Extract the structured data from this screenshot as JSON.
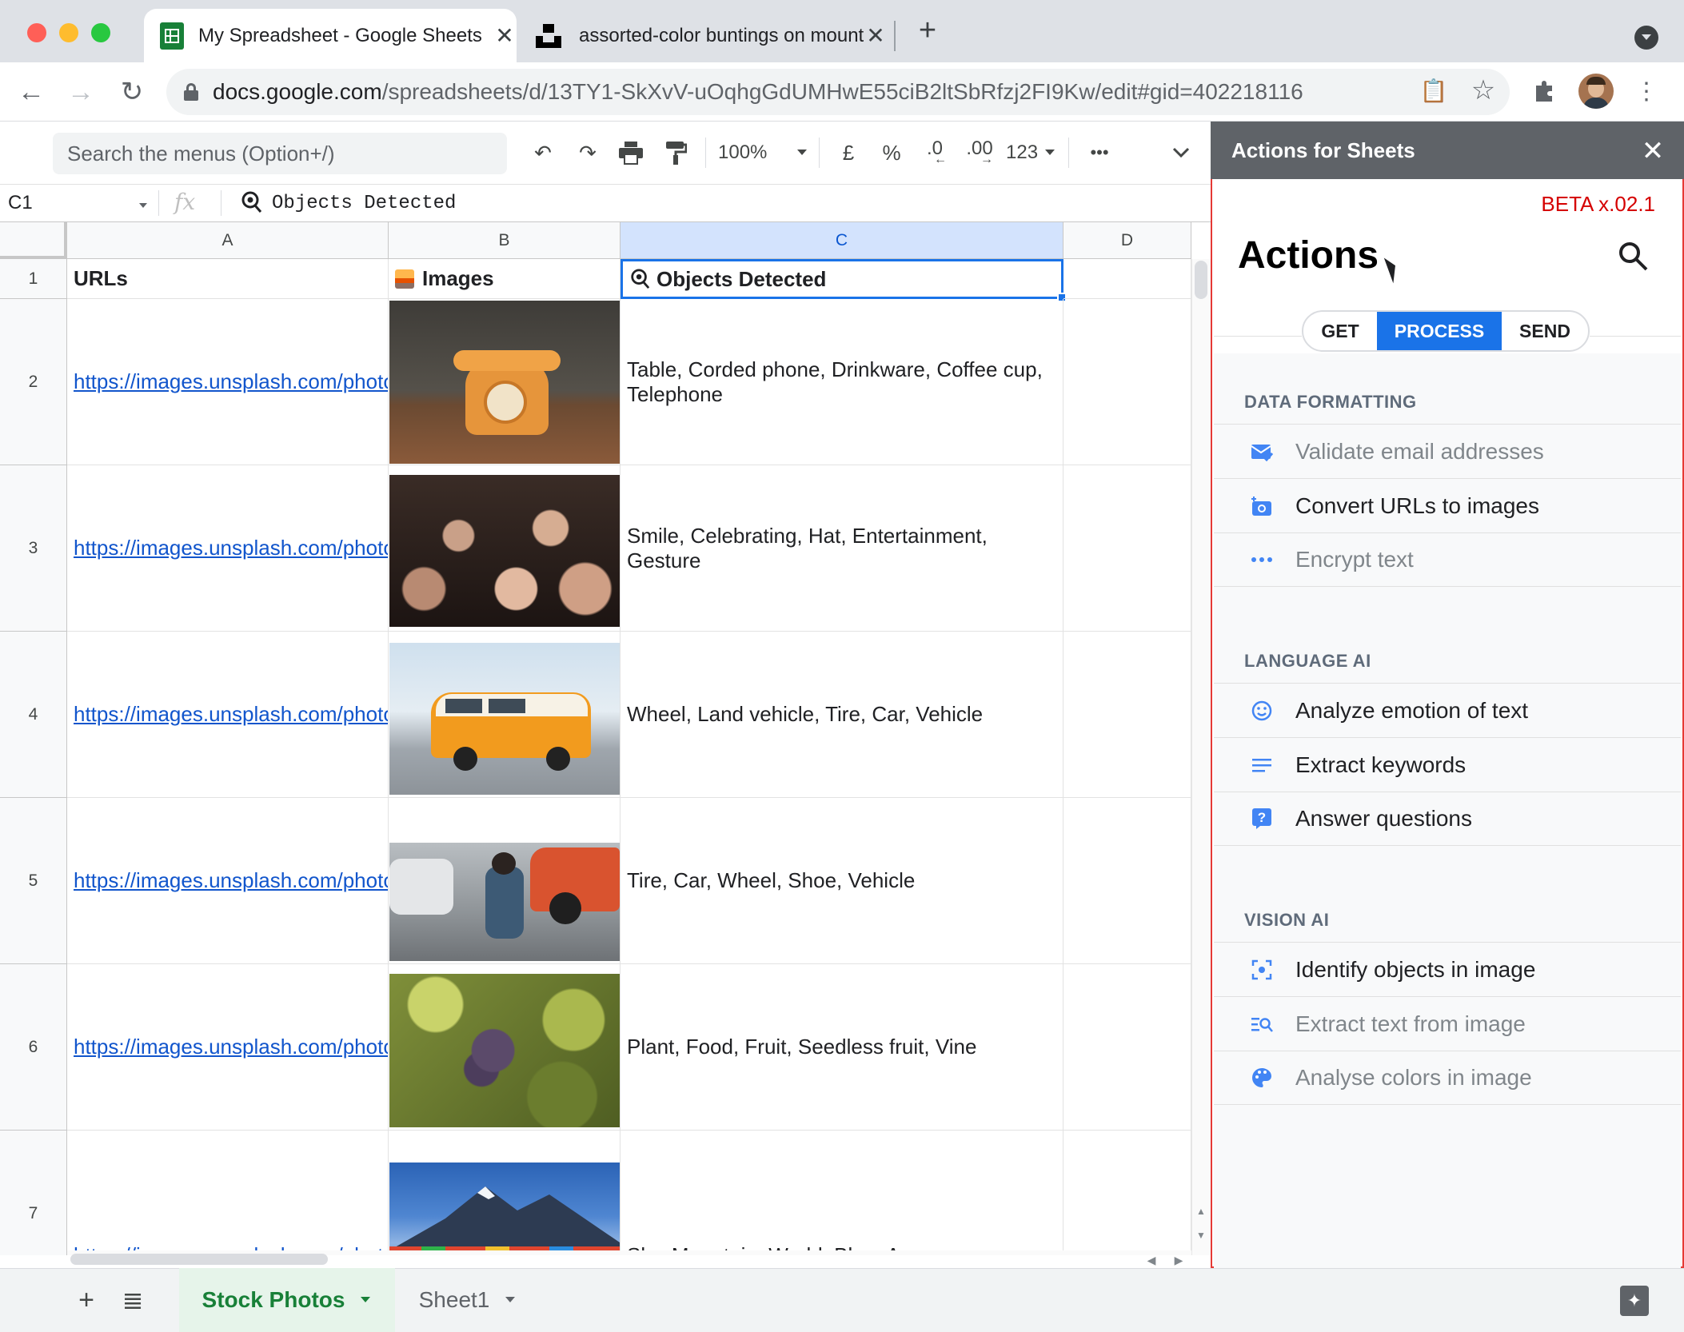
{
  "browser": {
    "tabs": [
      {
        "title": "My Spreadsheet - Google Sheets",
        "active": true
      },
      {
        "title": "assorted-color buntings on mountain",
        "active": false
      }
    ],
    "url_host": "docs.google.com",
    "url_path": "/spreadsheets/d/13TY1-SkXvV-uOqhgGdUMHwE55ciB2ltSbRfzj2FI9Kw/edit#gid=402218116"
  },
  "toolbar": {
    "search_placeholder": "Search the menus (Option+/)",
    "zoom": "100%",
    "currency": "£",
    "percent": "%",
    "dec_decrease": ".0",
    "dec_increase": ".00",
    "number_format": "123",
    "more": "•••"
  },
  "formula_bar": {
    "cell_ref": "C1",
    "fx": "fx",
    "content": "Objects Detected"
  },
  "grid": {
    "columns": [
      "A",
      "B",
      "C",
      "D"
    ],
    "header_row": {
      "row": "1",
      "a": "URLs",
      "b": "Images",
      "c": "Objects Detected"
    },
    "rows": [
      {
        "row": "2",
        "url": "https://images.unsplash.com/photo",
        "objects": "Table, Corded phone, Drinkware, Coffee cup, Telephone"
      },
      {
        "row": "3",
        "url": "https://images.unsplash.com/photo",
        "objects": "Smile, Celebrating, Hat, Entertainment, Gesture"
      },
      {
        "row": "4",
        "url": "https://images.unsplash.com/photo",
        "objects": "Wheel, Land vehicle, Tire, Car, Vehicle"
      },
      {
        "row": "5",
        "url": "https://images.unsplash.com/photo",
        "objects": "Tire, Car, Wheel, Shoe, Vehicle"
      },
      {
        "row": "6",
        "url": "https://images.unsplash.com/photo",
        "objects": "Plant, Food, Fruit, Seedless fruit, Vine"
      },
      {
        "row": "7",
        "url": "https://images.unsplash.com/photo",
        "objects": "Sky, Mountain, World, Blue, Azure"
      }
    ]
  },
  "sheet_tabs": [
    {
      "label": "Stock Photos",
      "active": true
    },
    {
      "label": "Sheet1",
      "active": false
    }
  ],
  "panel": {
    "title": "Actions for Sheets",
    "beta": "BETA x.02.1",
    "heading": "Actions",
    "segments": [
      "GET",
      "PROCESS",
      "SEND"
    ],
    "active_segment": "PROCESS",
    "sections": [
      {
        "title": "DATA FORMATTING",
        "items": [
          {
            "label": "Validate email addresses",
            "icon": "email-check-icon",
            "enabled": false
          },
          {
            "label": "Convert URLs to images",
            "icon": "add-photo-icon",
            "enabled": true
          },
          {
            "label": "Encrypt text",
            "icon": "dots-icon",
            "enabled": false
          }
        ]
      },
      {
        "title": "LANGUAGE AI",
        "items": [
          {
            "label": "Analyze emotion of text",
            "icon": "smiley-icon",
            "enabled": true
          },
          {
            "label": "Extract keywords",
            "icon": "lines-icon",
            "enabled": true
          },
          {
            "label": "Answer questions",
            "icon": "question-icon",
            "enabled": true
          }
        ]
      },
      {
        "title": "VISION AI",
        "items": [
          {
            "label": "Identify objects in image",
            "icon": "focus-icon",
            "enabled": true
          },
          {
            "label": "Extract text from image",
            "icon": "text-search-icon",
            "enabled": false
          },
          {
            "label": "Analyse colors in image",
            "icon": "palette-icon",
            "enabled": false
          }
        ]
      }
    ]
  },
  "colors": {
    "accent_blue": "#1a73e8",
    "link": "#1155cc",
    "sheets_green": "#188038",
    "beta_red": "#d50000",
    "panel_header": "#5f6368"
  }
}
